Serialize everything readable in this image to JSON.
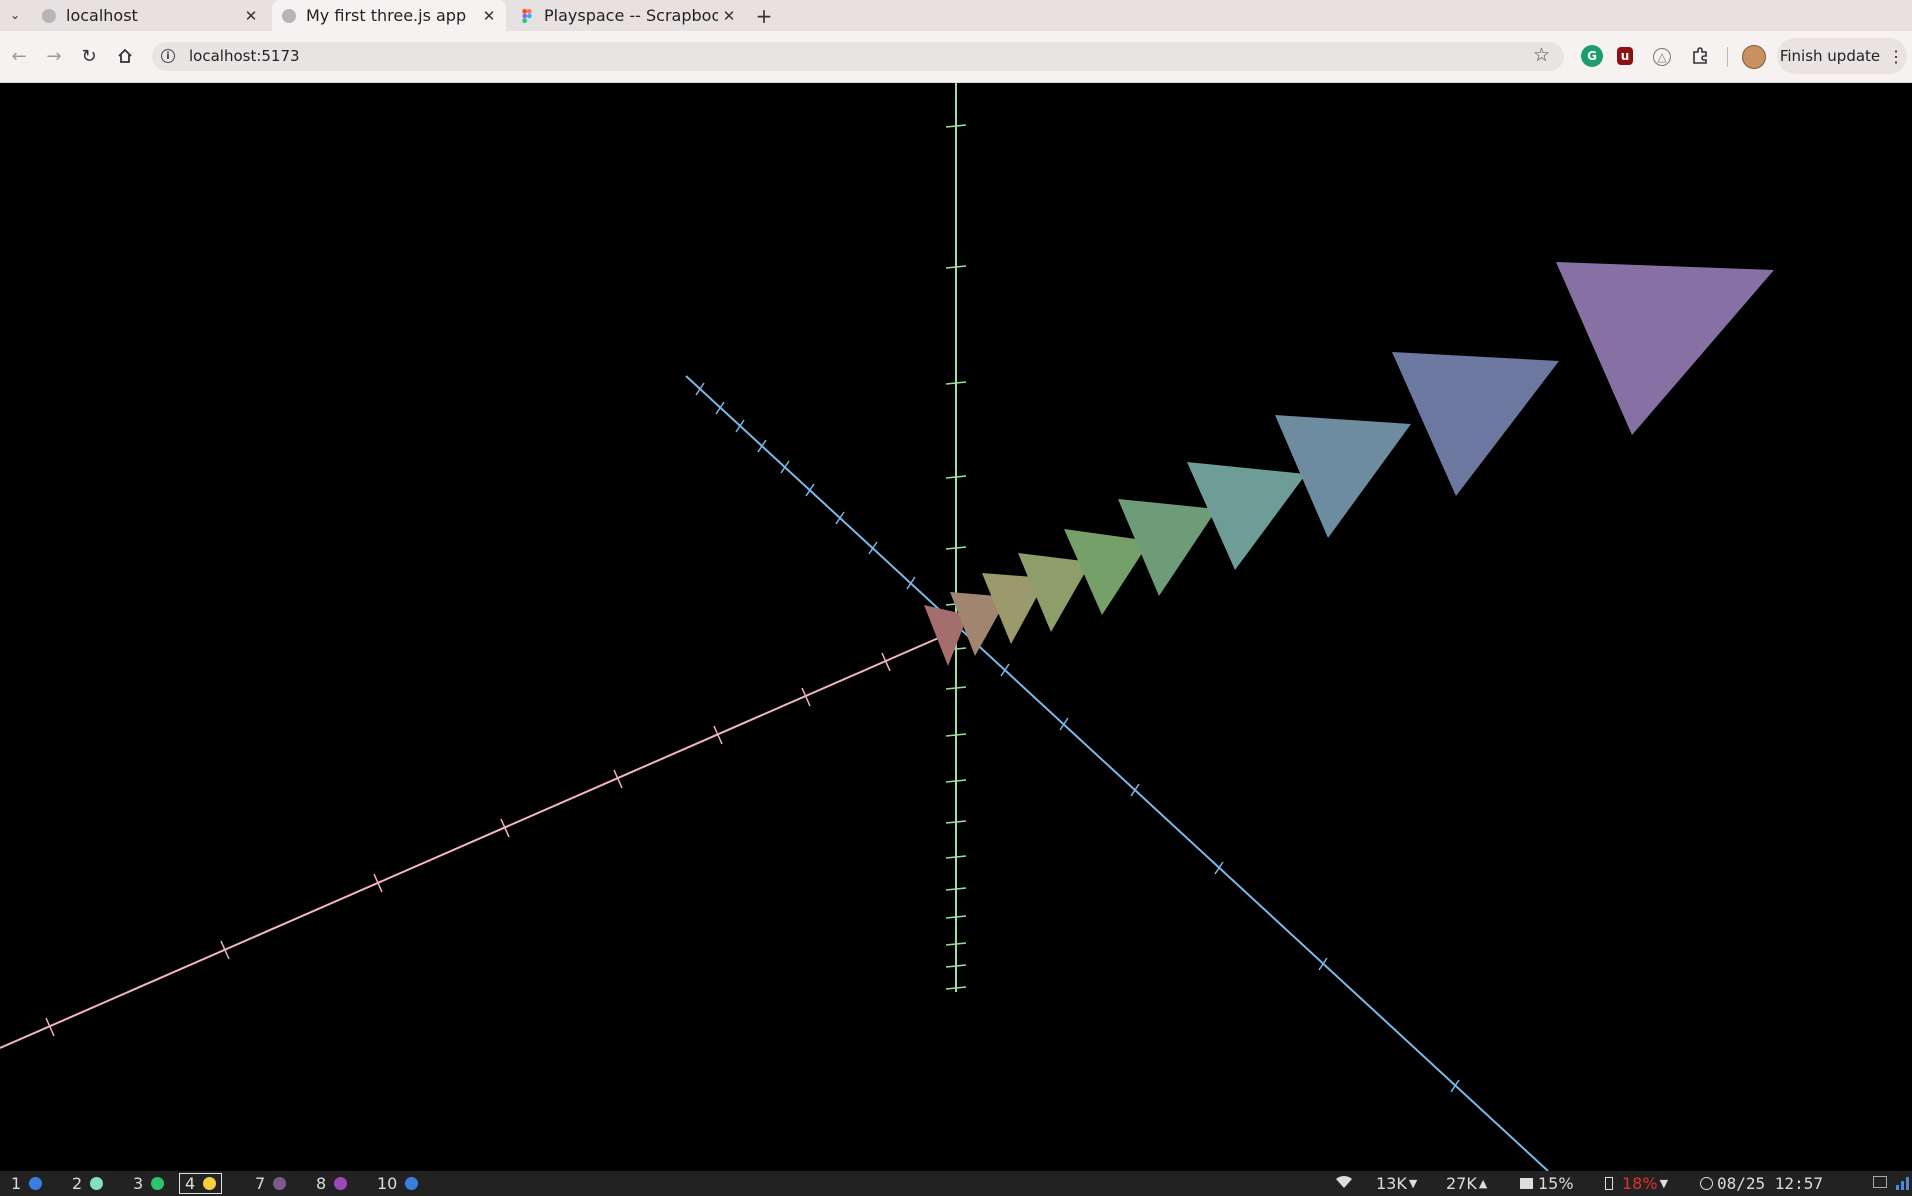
{
  "browser": {
    "tabs": [
      {
        "title": "localhost",
        "active": false
      },
      {
        "title": "My first three.js app",
        "active": true
      },
      {
        "title": "Playspace -- Scrapbook",
        "active": false
      }
    ],
    "url": "localhost:5173",
    "finish_update_label": "Finish update"
  },
  "scene": {
    "background": "#000000",
    "axis_colors": {
      "x": "#f4b4c4",
      "y": "#9ee0a0",
      "z": "#7ab8e8"
    },
    "triangle_colors": [
      "#a46e6c",
      "#a08670",
      "#9c9a6c",
      "#8e9e6a",
      "#76a06a",
      "#6e9c78",
      "#6e9c96",
      "#6e8ca0",
      "#6c78a0",
      "#8670a4"
    ]
  },
  "statusbar": {
    "workspaces": [
      {
        "num": "1",
        "color": "#3a7fe0",
        "active": false
      },
      {
        "num": "2",
        "color": "#7fe0c4",
        "active": false
      },
      {
        "num": "3",
        "color": "#2ec46e",
        "active": false
      },
      {
        "num": "4",
        "color": "#f4d03f",
        "active": true
      },
      {
        "num": "7",
        "color": "#7a5a8a",
        "active": false
      },
      {
        "num": "8",
        "color": "#9a4ab8",
        "active": false
      },
      {
        "num": "10",
        "color": "#3a7fe0",
        "active": false
      }
    ],
    "down_rate": "13K",
    "up_rate": "27K",
    "cpu": "15%",
    "battery": "18%",
    "datetime": "08/25 12:57"
  }
}
